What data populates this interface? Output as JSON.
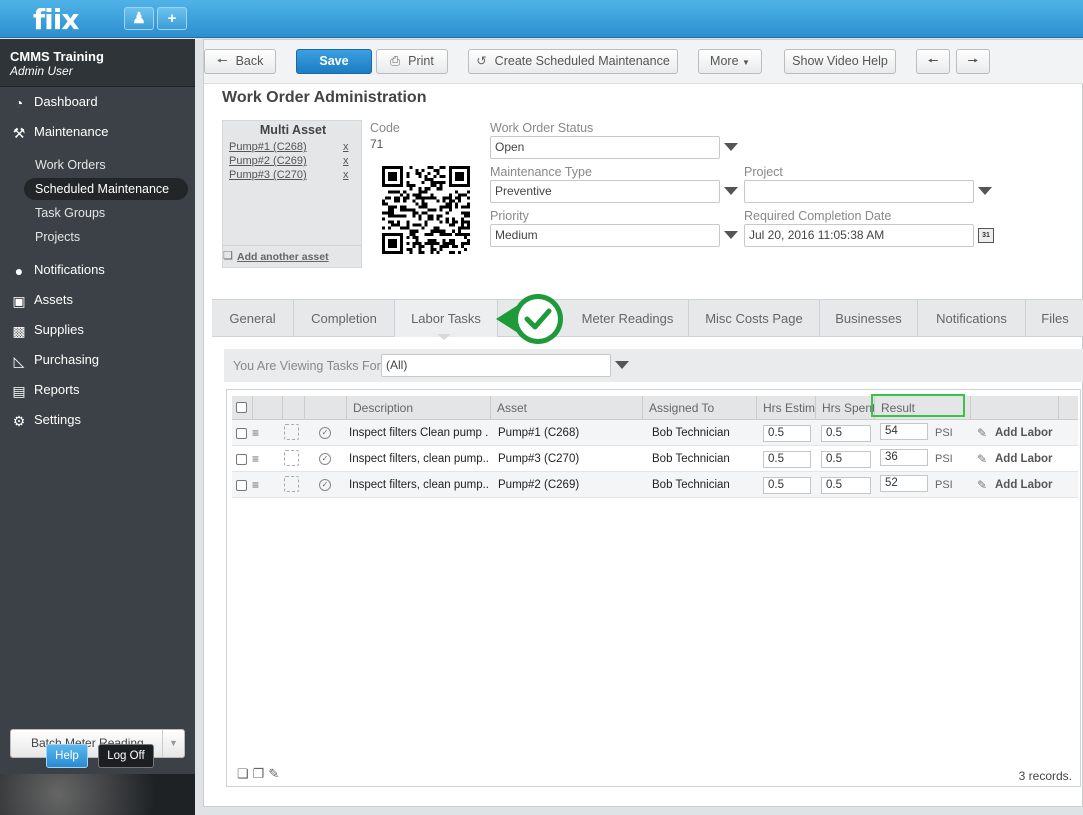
{
  "app": {
    "logo": "fiix"
  },
  "topbar": {
    "user_icon": "user-icon",
    "add_icon": "plus-icon"
  },
  "account": {
    "name": "CMMS Training",
    "user": "Admin User"
  },
  "nav": {
    "items": [
      {
        "label": "Dashboard",
        "icon": "dashboard-icon"
      },
      {
        "label": "Maintenance",
        "icon": "tools-icon"
      },
      {
        "label": "Notifications",
        "icon": "chat-icon"
      },
      {
        "label": "Assets",
        "icon": "boxes-icon"
      },
      {
        "label": "Supplies",
        "icon": "truck-icon"
      },
      {
        "label": "Purchasing",
        "icon": "cart-icon"
      },
      {
        "label": "Reports",
        "icon": "chart-icon"
      },
      {
        "label": "Settings",
        "icon": "gear-icon"
      }
    ],
    "subitems": [
      "Work Orders",
      "Scheduled Maintenance",
      "Task Groups",
      "Projects"
    ],
    "active_sub": "Scheduled Maintenance"
  },
  "sidebar_footer": {
    "batch": "Batch Meter Reading",
    "help": "Help",
    "logoff": "Log Off"
  },
  "toolbar": {
    "back": "Back",
    "save": "Save",
    "print": "Print",
    "create_sm": "Create Scheduled Maintenance",
    "more": "More",
    "video_help": "Show Video Help"
  },
  "page": {
    "title": "Work Order Administration"
  },
  "multi_asset": {
    "title": "Multi Asset",
    "assets": [
      "Pump#1 (C268)",
      "Pump#2 (C269)",
      "Pump#3 (C270)"
    ],
    "remove": "x",
    "add_label": "Add another asset"
  },
  "form": {
    "code_label": "Code",
    "code_value": "71",
    "status_label": "Work Order Status",
    "status_value": "Open",
    "mtype_label": "Maintenance Type",
    "mtype_value": "Preventive",
    "project_label": "Project",
    "project_value": "",
    "priority_label": "Priority",
    "priority_value": "Medium",
    "rcd_label": "Required Completion Date",
    "rcd_value": "Jul 20, 2016 11:05:38 AM",
    "calendar_icon_text": "31"
  },
  "tabs": [
    "General",
    "Completion",
    "Labor Tasks",
    "Meter Readings",
    "Misc Costs Page",
    "Businesses",
    "Notifications",
    "Files"
  ],
  "active_tab": "Labor Tasks",
  "viewing": {
    "label": "You Are Viewing Tasks For",
    "value": "(All)"
  },
  "grid": {
    "columns": [
      "Description",
      "Asset",
      "Assigned To",
      "Hrs Estim",
      "Hrs Spent",
      "Result"
    ],
    "rows": [
      {
        "description": "Inspect filters Clean pump ...",
        "asset": "Pump#1 (C268)",
        "assigned": "Bob Technician",
        "hrs_est": "0.5",
        "hrs_spent": "0.5",
        "result": "54",
        "unit": "PSI",
        "action": "Add Labor"
      },
      {
        "description": "Inspect filters, clean pump...",
        "asset": "Pump#3 (C270)",
        "assigned": "Bob Technician",
        "hrs_est": "0.5",
        "hrs_spent": "0.5",
        "result": "36",
        "unit": "PSI",
        "action": "Add Labor"
      },
      {
        "description": "Inspect filters, clean pump...",
        "asset": "Pump#2 (C269)",
        "assigned": "Bob Technician",
        "hrs_est": "0.5",
        "hrs_spent": "0.5",
        "result": "52",
        "unit": "PSI",
        "action": "Add Labor"
      }
    ],
    "records": "3 records."
  },
  "colors": {
    "accent": "#2c8fcf",
    "highlight": "#3cc14a",
    "sidebar": "#3b4146"
  }
}
